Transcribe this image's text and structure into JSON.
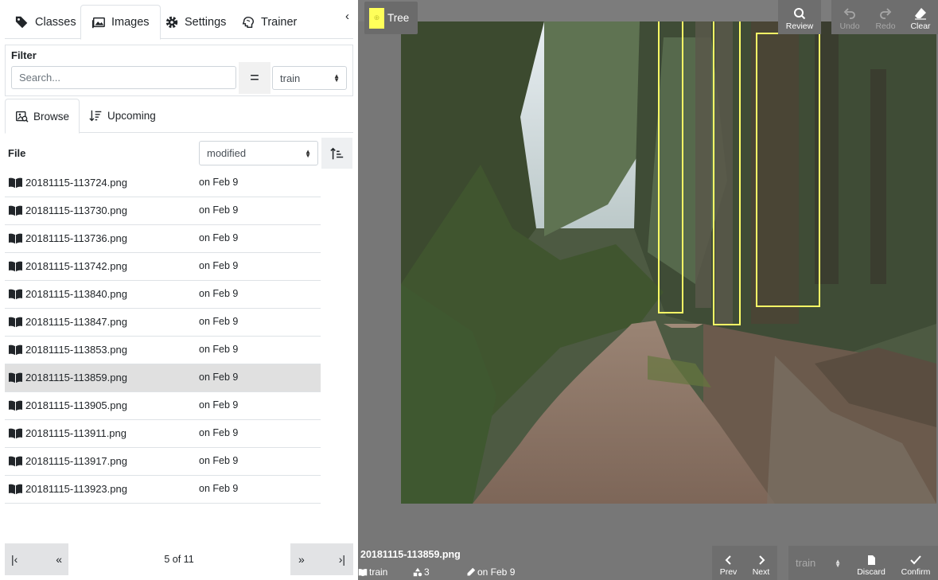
{
  "tabs": [
    {
      "label": "Classes",
      "icon": "tags-icon"
    },
    {
      "label": "Images",
      "icon": "images-icon"
    },
    {
      "label": "Settings",
      "icon": "gear-icon"
    },
    {
      "label": "Trainer",
      "icon": "brain-icon"
    }
  ],
  "collapse_glyph": "‹",
  "filter": {
    "label": "Filter",
    "search_placeholder": "Search...",
    "search_value": "",
    "operator": "=",
    "split_value": "train"
  },
  "subtabs": [
    {
      "label": "Browse",
      "icon": "browse-icon"
    },
    {
      "label": "Upcoming",
      "icon": "sort-icon"
    }
  ],
  "file_list": {
    "column_label": "File",
    "sort_value": "modified",
    "selected_index": 7,
    "files": [
      {
        "name": "20181115-113724.png",
        "date": "on Feb 9"
      },
      {
        "name": "20181115-113730.png",
        "date": "on Feb 9"
      },
      {
        "name": "20181115-113736.png",
        "date": "on Feb 9"
      },
      {
        "name": "20181115-113742.png",
        "date": "on Feb 9"
      },
      {
        "name": "20181115-113840.png",
        "date": "on Feb 9"
      },
      {
        "name": "20181115-113847.png",
        "date": "on Feb 9"
      },
      {
        "name": "20181115-113853.png",
        "date": "on Feb 9"
      },
      {
        "name": "20181115-113859.png",
        "date": "on Feb 9"
      },
      {
        "name": "20181115-113905.png",
        "date": "on Feb 9"
      },
      {
        "name": "20181115-113911.png",
        "date": "on Feb 9"
      },
      {
        "name": "20181115-113917.png",
        "date": "on Feb 9"
      },
      {
        "name": "20181115-113923.png",
        "date": "on Feb 9"
      }
    ]
  },
  "pagination": {
    "first_glyph": "|‹",
    "prev_glyph": "«",
    "next_glyph": "»",
    "last_glyph": "›|",
    "text": "5 of 11"
  },
  "viewer": {
    "active_class": "Tree",
    "class_color": "#ffff5a",
    "toolbar": [
      {
        "label": "Review",
        "icon": "search-icon",
        "enabled": true
      },
      {
        "label": "Undo",
        "icon": "undo-icon",
        "enabled": false
      },
      {
        "label": "Redo",
        "icon": "redo-icon",
        "enabled": false
      },
      {
        "label": "Clear",
        "icon": "eraser-icon",
        "enabled": true
      }
    ],
    "image_name": "20181115-113859.png",
    "image_split": "train",
    "annotation_count": "3",
    "image_modified": "on Feb 9",
    "nav": {
      "prev": "Prev",
      "next": "Next"
    },
    "split_select": "train",
    "actions": {
      "discard": "Discard",
      "confirm": "Confirm"
    }
  }
}
